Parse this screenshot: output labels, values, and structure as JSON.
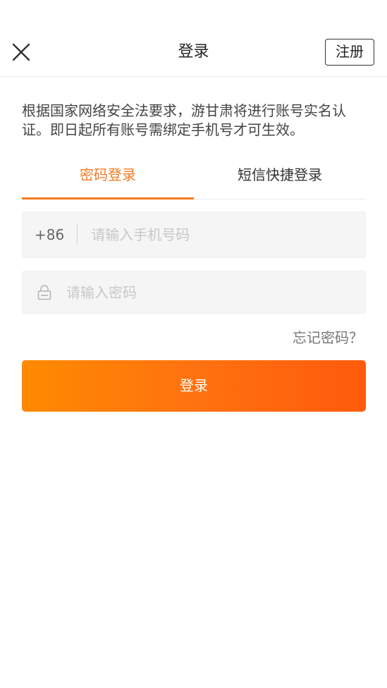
{
  "header": {
    "title": "登录",
    "register_label": "注册"
  },
  "notice": "根据国家网络安全法要求，游甘肃将进行账号实名认证。即日起所有账号需绑定手机号才可生效。",
  "tabs": [
    {
      "label": "密码登录",
      "active": true
    },
    {
      "label": "短信快捷登录",
      "active": false
    }
  ],
  "phone_field": {
    "prefix": "+86",
    "placeholder": "请输入手机号码",
    "value": ""
  },
  "password_field": {
    "placeholder": "请输入密码",
    "value": ""
  },
  "forgot_label": "忘记密码？",
  "login_button_label": "登录",
  "colors": {
    "accent": "#f47b20",
    "button_gradient_start": "#ff8a00",
    "button_gradient_end": "#ff5a0c"
  },
  "icons": {
    "close": "close-icon",
    "lock": "lock-icon"
  }
}
